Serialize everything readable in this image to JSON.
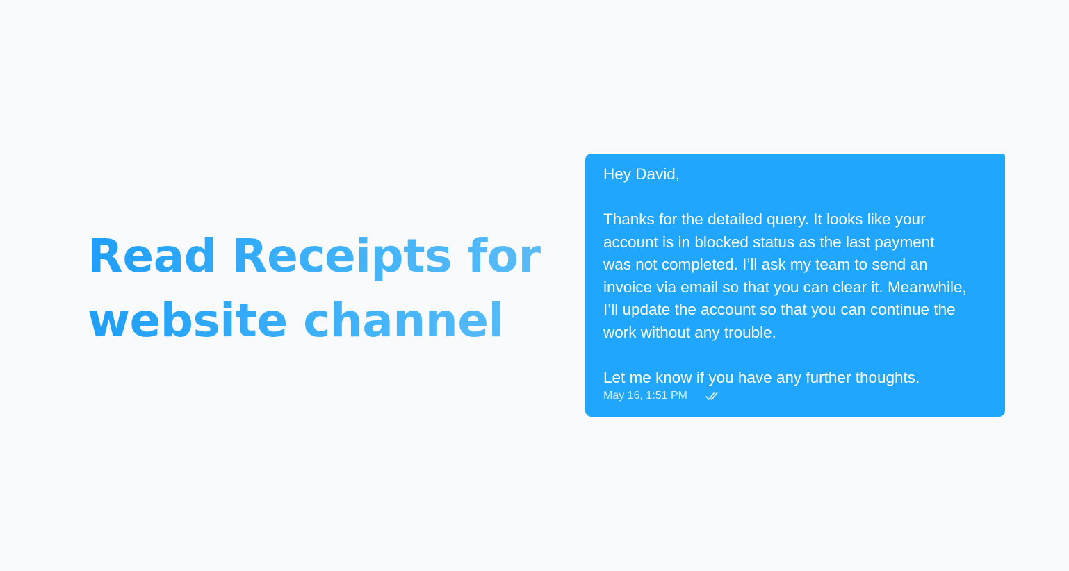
{
  "headline": {
    "line1": "Read Receipts for",
    "line2": "website channel"
  },
  "message": {
    "greeting": "Hey David,",
    "body_lines": [
      "Thanks for the detailed query. It looks like your",
      "account is in blocked status as the last payment",
      "was not completed. I’ll ask my team to send an",
      "invoice via email so that you can clear it. Meanwhile,",
      "I’ll update the account so that you can continue the",
      "work without any trouble."
    ],
    "closing": "Let me know if you have any further thoughts.",
    "timestamp": "May 16, 1:51 PM",
    "status_icon": "double-check-icon",
    "bubble_color": "#20a6fd"
  },
  "colors": {
    "background": "#f8fafb",
    "headline_accent": "#2aa8fb"
  }
}
